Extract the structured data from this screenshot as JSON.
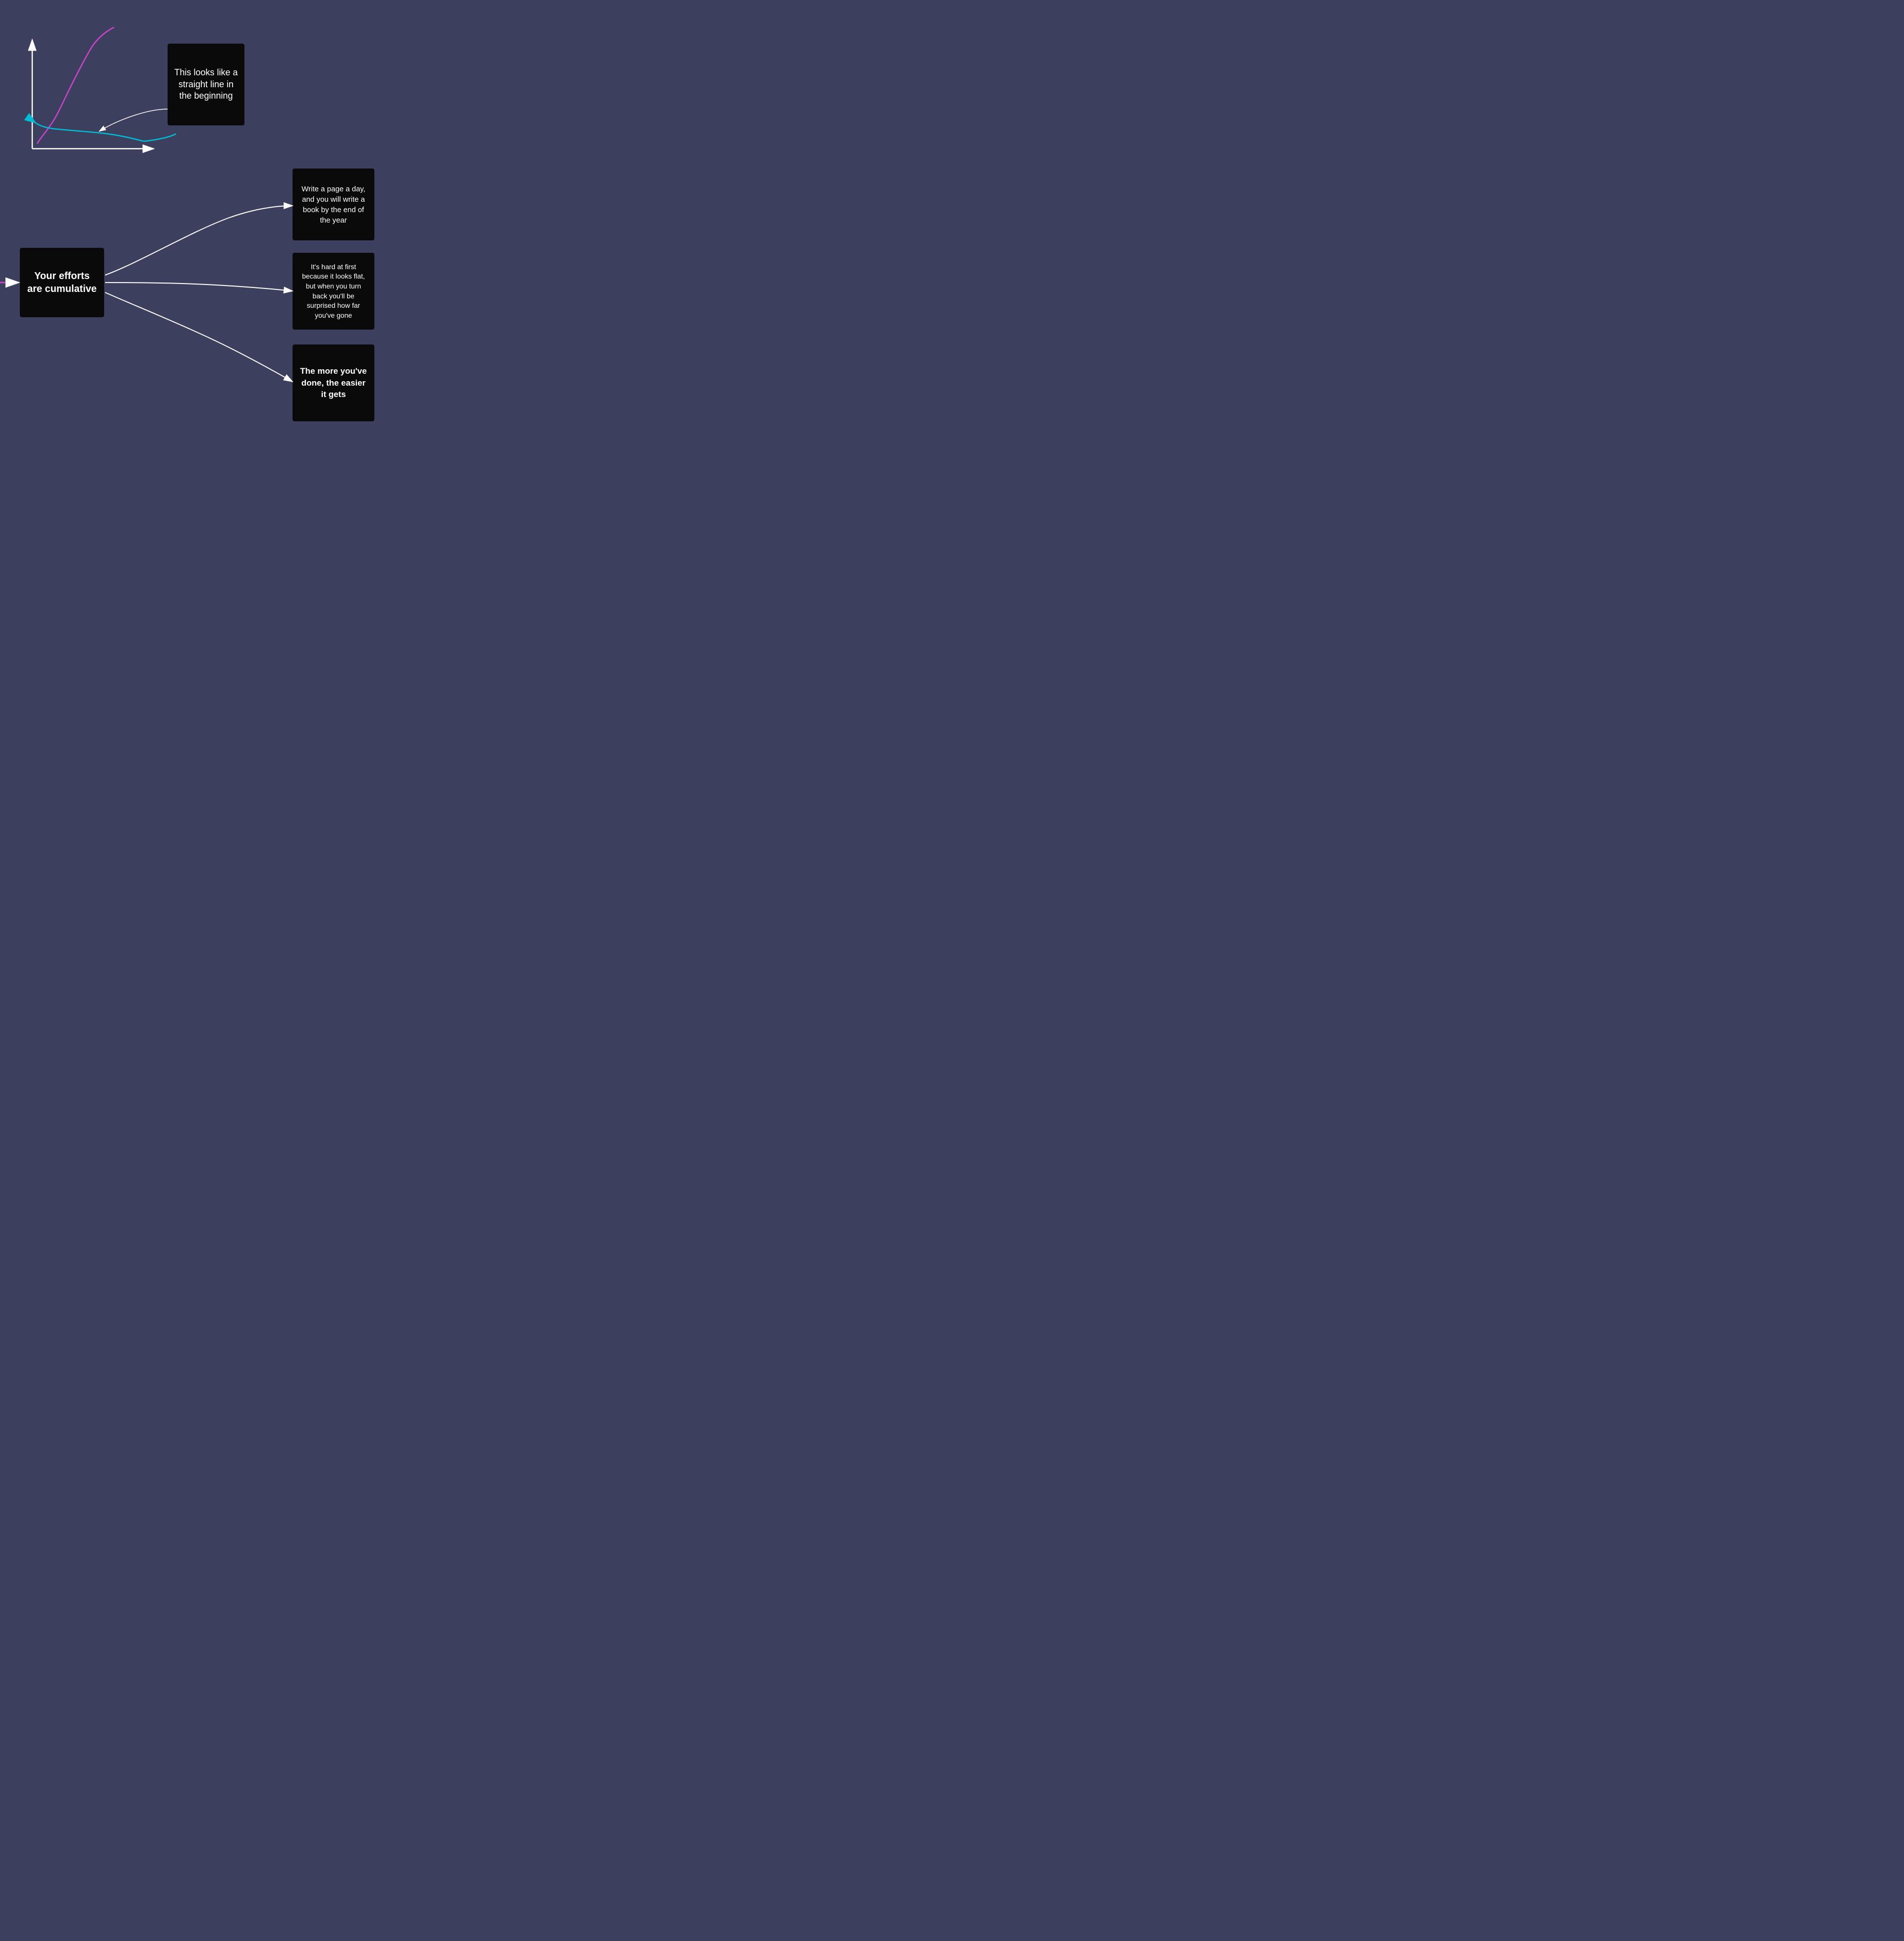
{
  "background_color": "#3d3f5e",
  "cards": {
    "straight_line": {
      "text": "This looks like a straight line in the beginning"
    },
    "efforts": {
      "text": "Your efforts are cumulative"
    },
    "write_page": {
      "text": "Write a page a day, and you will write a book by the end of the year"
    },
    "hard_first": {
      "text": "It's hard at first because it looks flat, but when you turn back you'll be surprised how far you've gone"
    },
    "easier": {
      "text": "The more you've done, the easier it gets"
    }
  },
  "arrows": {
    "incoming_label": "incoming arrow",
    "chart_label": "exponential curve chart"
  }
}
